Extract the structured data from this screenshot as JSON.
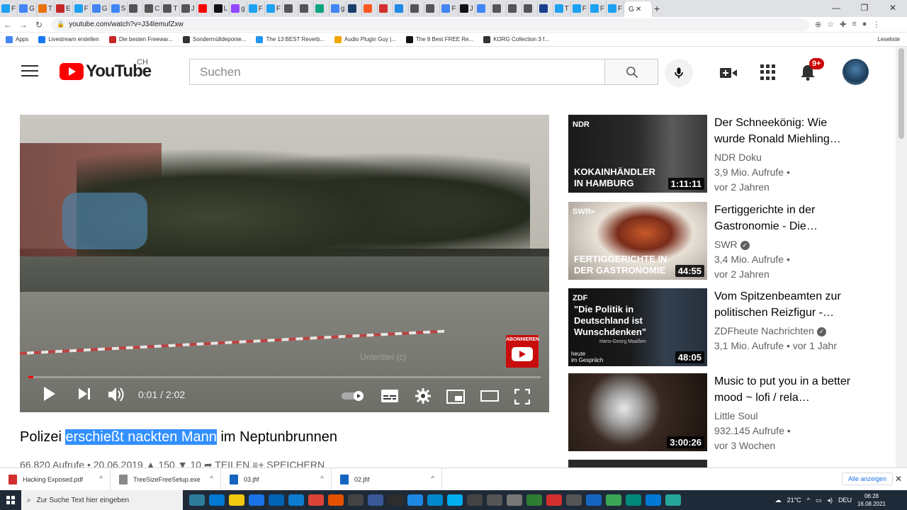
{
  "browser": {
    "tabs": [
      {
        "label": "F",
        "color": "#1da1f2"
      },
      {
        "label": "G",
        "color": "#4285f4"
      },
      {
        "label": "T",
        "color": "#e8710a"
      },
      {
        "label": "E",
        "color": "#c62828"
      },
      {
        "label": "F",
        "color": "#1da1f2"
      },
      {
        "label": "G",
        "color": "#4285f4"
      },
      {
        "label": "S",
        "color": "#4285f4"
      },
      {
        "label": "",
        "color": "#555"
      },
      {
        "label": "C",
        "color": "#555"
      },
      {
        "label": "T",
        "color": "#555"
      },
      {
        "label": "J",
        "color": "#555"
      },
      {
        "label": "",
        "color": "#ff0000"
      },
      {
        "label": "L",
        "color": "#111"
      },
      {
        "label": "g",
        "color": "#9146ff"
      },
      {
        "label": "F",
        "color": "#1da1f2"
      },
      {
        "label": "F",
        "color": "#1da1f2"
      },
      {
        "label": "",
        "color": "#555"
      },
      {
        "label": "",
        "color": "#555"
      },
      {
        "label": "",
        "color": "#10a37f"
      },
      {
        "label": "g",
        "color": "#4285f4"
      },
      {
        "label": "",
        "color": "#1a3d6b"
      },
      {
        "label": "",
        "color": "#ff5722"
      },
      {
        "label": "",
        "color": "#d32f2f"
      },
      {
        "label": "",
        "color": "#1e88e5"
      },
      {
        "label": "",
        "color": "#555"
      },
      {
        "label": "",
        "color": "#555"
      },
      {
        "label": "F",
        "color": "#4285f4"
      },
      {
        "label": "J",
        "color": "#111"
      },
      {
        "label": "",
        "color": "#4285f4"
      },
      {
        "label": "",
        "color": "#555"
      },
      {
        "label": "",
        "color": "#555"
      },
      {
        "label": "",
        "color": "#555"
      },
      {
        "label": "",
        "color": "#1a3d8f"
      },
      {
        "label": "T",
        "color": "#1da1f2"
      },
      {
        "label": "F",
        "color": "#1da1f2"
      },
      {
        "label": "F",
        "color": "#1da1f2"
      },
      {
        "label": "F",
        "color": "#1da1f2"
      }
    ],
    "active_tab_label": "G",
    "new_tab_symbol": "+",
    "url": "youtube.com/watch?v=J34lemufZxw",
    "window_controls": {
      "minimize": "—",
      "maximize": "❐",
      "close": "✕"
    }
  },
  "bookmarks": [
    {
      "label": "Apps",
      "color": "#4285f4"
    },
    {
      "label": "Livestream erstellen",
      "color": "#1877f2"
    },
    {
      "label": "Die besten Freewar...",
      "color": "#c62828"
    },
    {
      "label": "Sondermülldeponie...",
      "color": "#333"
    },
    {
      "label": "The 13 BEST Reverb...",
      "color": "#2196f3"
    },
    {
      "label": "Audio Plugin Guy |...",
      "color": "#f0a500"
    },
    {
      "label": "The 8 Best FREE Re...",
      "color": "#111"
    },
    {
      "label": "KORG Collection 3 f...",
      "color": "#333"
    }
  ],
  "bookmarks_right": "Leseliste",
  "youtube": {
    "logo_text": "YouTube",
    "country": "CH",
    "search_placeholder": "Suchen",
    "notification_count": "9+"
  },
  "video": {
    "current_time": "0:01",
    "duration": "2:02",
    "time_display": "0:01 / 2:02",
    "progress_fraction": 0.01,
    "subscribe_label": "ABONNIEREN",
    "subtitle_hint": "Untertitel (c)"
  },
  "title": {
    "before": "Polizei ",
    "highlighted": "erschießt nackten Mann",
    "after": " im Neptunbrunnen"
  },
  "meta_partial": "66.820 Aufrufe • 20.06.2019        ▲ 150    ▼ 10      ➦ TEILEN     ≡+ SPEICHERN",
  "recommendations": [
    {
      "title": "Der Schneekönig: Wie wurde Ronald Miehling…",
      "channel": "NDR Doku",
      "verified": false,
      "views": "3,9 Mio. Aufrufe •",
      "age": "vor 2 Jahren",
      "duration": "1:11:11",
      "thumb_caption": "KOKAINHÄNDLER\nIN HAMBURG",
      "thumb_logo": "NDR"
    },
    {
      "title": "Fertiggerichte in der Gastronomie - Die…",
      "channel": "SWR",
      "verified": true,
      "views": "3,4 Mio. Aufrufe •",
      "age": "vor 2 Jahren",
      "duration": "44:55",
      "thumb_caption": "FERTIGGERICHTE IN\nDER GASTRONOMIE",
      "thumb_logo": "SWR»"
    },
    {
      "title": "Vom Spitzenbeamten zur politischen Reizfigur -…",
      "channel": "ZDFheute Nachrichten",
      "verified": true,
      "views": "3,1 Mio. Aufrufe • vor 1 Jahr",
      "age": "",
      "duration": "48:05",
      "thumb_caption": "\"Die Politik in\nDeutschland ist\nWunschdenken\"",
      "thumb_logo": "ZDF",
      "thumb_sub": "Hans-Georg Maaßen",
      "thumb_brand": "heute\nim Gespräch"
    },
    {
      "title": "Music to put you in a better mood ~ lofi / rela…",
      "channel": "Little Soul",
      "verified": false,
      "views": "932.145 Aufrufe •",
      "age": "vor 3 Wochen",
      "duration": "3:00:26",
      "thumb_caption": "",
      "thumb_logo": ""
    }
  ],
  "downloads": [
    {
      "name": "Hacking Exposed.pdf",
      "color": "#d32f2f"
    },
    {
      "name": "TreeSizeFreeSetup.exe",
      "color": "#888"
    },
    {
      "name": "03.jfif",
      "color": "#1565c0"
    },
    {
      "name": "02.jfif",
      "color": "#1565c0"
    }
  ],
  "downloads_show_all": "Alle anzeigen",
  "taskbar": {
    "search_placeholder": "Zur Suche Text hier eingeben",
    "temperature": "21°C",
    "language": "DEU",
    "time": "06:28",
    "date": "16.08.2021"
  }
}
